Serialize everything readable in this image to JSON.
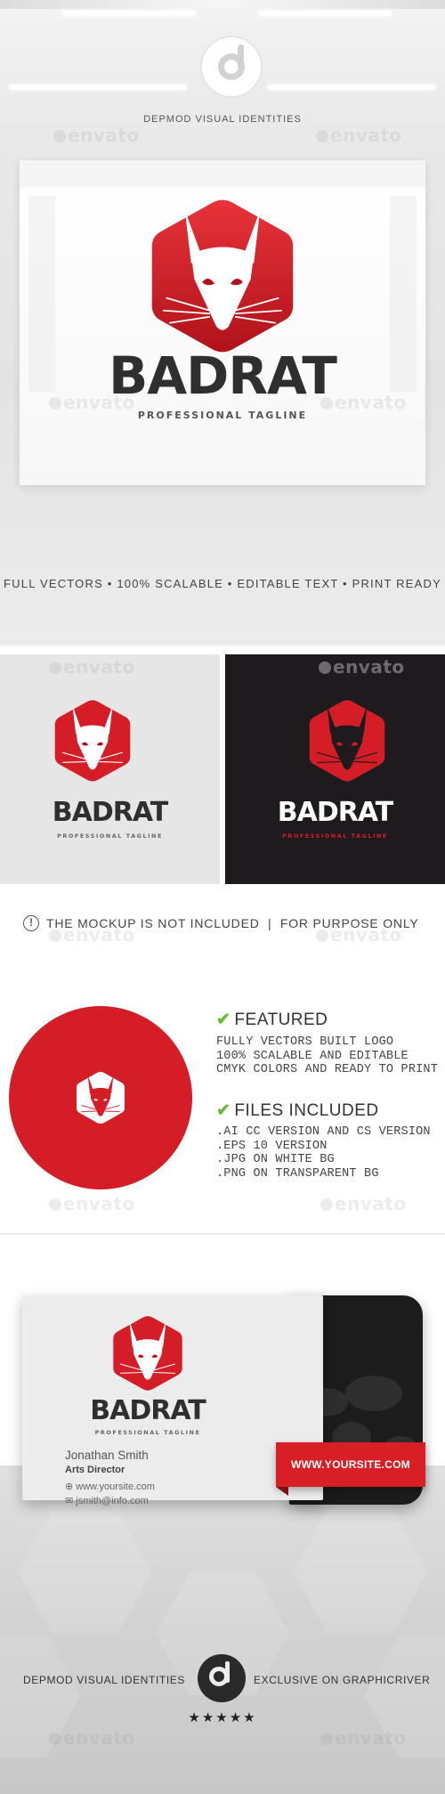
{
  "header": {
    "brand_label": "DEPMOD VISUAL IDENTITIES",
    "logo_icon": "depmod-d-logo-icon"
  },
  "watermark": {
    "text": "envato"
  },
  "logo": {
    "name_part1": "BAD",
    "name_part2": "RAT",
    "tagline": "PROFESSIONAL TAGLINE",
    "icon": "rat-head-hexagon-icon",
    "brand_color": "#d41d27",
    "dark_text_color": "#2f2f2f"
  },
  "features_line": "FULL VECTORS • 100% SCALABLE • EDITABLE TEXT • PRINT READY",
  "notice": {
    "icon": "exclamation-circle-icon",
    "text": "THE MOCKUP IS NOT INCLUDED  |  FOR PURPOSE ONLY"
  },
  "featured": {
    "heading": "FEATURED",
    "icon": "check-icon",
    "items": [
      "FULLY VECTORS BUILT LOGO",
      "100% SCALABLE AND EDITABLE",
      "CMYK COLORS AND READY TO PRINT"
    ]
  },
  "files": {
    "heading": "FILES INCLUDED",
    "icon": "check-icon",
    "items": [
      ".AI CC VERSION AND CS VERSION",
      ".EPS 10 VERSION",
      ".JPG ON WHITE BG",
      ".PNG ON TRANSPARENT BG"
    ]
  },
  "business_card": {
    "person_name": "Jonathan Smith",
    "role": "Arts Director",
    "website": "www.yoursite.com",
    "email": "jsmith@info.com",
    "website_icon": "globe-icon",
    "email_icon": "envelope-icon",
    "ribbon_text": "WWW.YOURSITE.COM"
  },
  "footer": {
    "left_label": "DEPMOD VISUAL IDENTITIES",
    "right_label": "EXCLUSIVE ON GRAPHICRIVER",
    "stars": "★★★★★",
    "rating_out_of_5": 5
  }
}
